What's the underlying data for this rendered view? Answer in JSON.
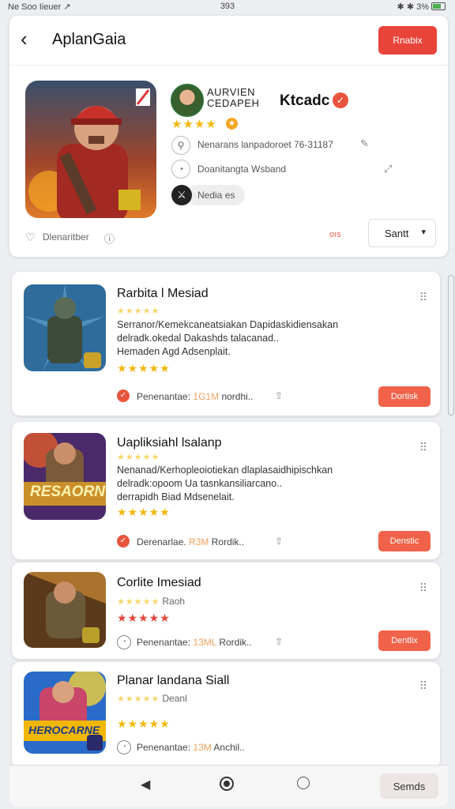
{
  "status_bar": {
    "left": "Ne Soo Iieuer ↗",
    "center": "393",
    "right": "✱ ✱ 3%"
  },
  "header": {
    "title": "AplanGaia",
    "action_label": "Rnabix"
  },
  "featured": {
    "publisher_line1": "AURVIEN",
    "publisher_line2": "CEDAPEH",
    "brand": "Ktcadc",
    "stars": "★★★★",
    "meta1": "Nenarans lanpadoroet 76-31187",
    "meta2": "Doanitangta Wsband",
    "tag": "Nedia es",
    "footer_text": "Dlenaritber",
    "accent_small": "oıs",
    "sort_label": "Santt"
  },
  "apps": [
    {
      "title": "Rarbita l Mesiad",
      "subtitle_stars": "★★★★★",
      "desc1": "Serranor/Kemekcaneatsiakan Dapidaskidiensakan",
      "desc2": "delradk.okedal Dakashds talacanad..",
      "desc3": "Hemaden Agd Adsenplait.",
      "stars": "★★★★★",
      "footer_label": "Penenantae:",
      "footer_size": "1G1M",
      "footer_extra": "nordhi..",
      "button": "Dortisk",
      "icon_color": "#2b5d8c"
    },
    {
      "title": "Uapliksiahl lsalanp",
      "subtitle_stars": "★★★★★",
      "desc1": "Nenanad/Kerhopleoiotiekan dlaplasaidhipischkan",
      "desc2": "delradk:opoom Ua tasnkansiliarcano..",
      "desc3": "derrapidh Biad Mdsenelait.",
      "stars": "★★★★★",
      "footer_label": "Derenarlae.",
      "footer_size": "R3M",
      "footer_extra": "Rordik..",
      "button": "Denstic",
      "thumb_label": "RESAORN"
    },
    {
      "title": "Corlite Imesiad",
      "subtitle_stars": "★★★★★",
      "subtitle_text": "Raoh",
      "stars": "★★★★★",
      "footer_label": "Penenantae:",
      "footer_size": "13ML",
      "footer_extra": "Rordik..",
      "button": "Dentlix"
    },
    {
      "title": "Planar landana Siall",
      "subtitle_stars": "★★★★★",
      "subtitle_text": "Deanl",
      "stars": "★★★★★",
      "footer_label": "Penenantae:",
      "footer_size": "13M",
      "footer_extra": "Anchil..",
      "thumb_label": "HEROCARNE"
    }
  ],
  "navbar": {
    "button": "Semds"
  }
}
